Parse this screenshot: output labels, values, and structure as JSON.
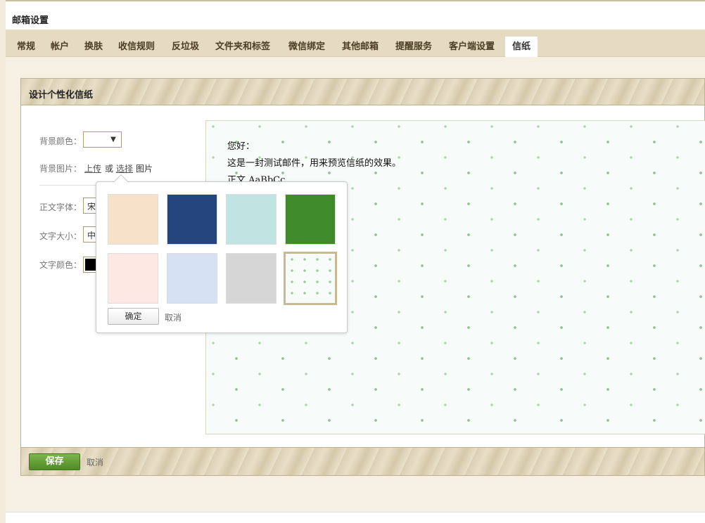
{
  "page": {
    "title": "邮箱设置"
  },
  "tabs": [
    {
      "label": "常规"
    },
    {
      "label": "帐户"
    },
    {
      "label": "换肤"
    },
    {
      "label": "收信规则"
    },
    {
      "label": "反垃圾"
    },
    {
      "label": "文件夹和标签"
    },
    {
      "label": "微信绑定"
    },
    {
      "label": "其他邮箱"
    },
    {
      "label": "提醒服务"
    },
    {
      "label": "客户端设置"
    },
    {
      "label": "信纸",
      "active": true
    }
  ],
  "panel": {
    "title": "设计个性化信纸",
    "form": {
      "bg_color_label": "背景颜色：",
      "bg_image_label": "背景图片：",
      "upload_link": "上传",
      "or_text": "或",
      "choose_link": "选择",
      "image_text": "图片",
      "font_label": "正文字体：",
      "font_value": "宋",
      "size_label": "文字大小：",
      "size_value": "中",
      "text_color_label": "文字颜色：",
      "text_color_value": "#000000"
    },
    "preview": {
      "greeting": "您好：",
      "body": "这是一封测试邮件，用来预览信纸的效果。",
      "sample": "正文 AaBbCc"
    },
    "footer": {
      "save_label": "保存",
      "cancel_label": "取消"
    }
  },
  "popup": {
    "thumbnails": [
      {
        "name": "beige-parchment",
        "color": "#f6e2c8"
      },
      {
        "name": "navy-texture",
        "color": "#24457e"
      },
      {
        "name": "aqua-damask",
        "color": "#bfe4e2"
      },
      {
        "name": "green-grass",
        "color": "#3f8a2a"
      },
      {
        "name": "pink-floral",
        "color": "#fde8e4"
      },
      {
        "name": "light-blue-floral",
        "color": "#d4e2f4"
      },
      {
        "name": "gray-marble",
        "color": "#d6d6d6"
      },
      {
        "name": "white-leaf-pattern",
        "color": "#f7fbf9",
        "selected": true
      }
    ],
    "ok_label": "确定",
    "cancel_label": "取消"
  },
  "colors": {
    "accent_green": "#5a9830",
    "tab_bar": "#e4dbc2",
    "panel_border": "#bfb190"
  }
}
